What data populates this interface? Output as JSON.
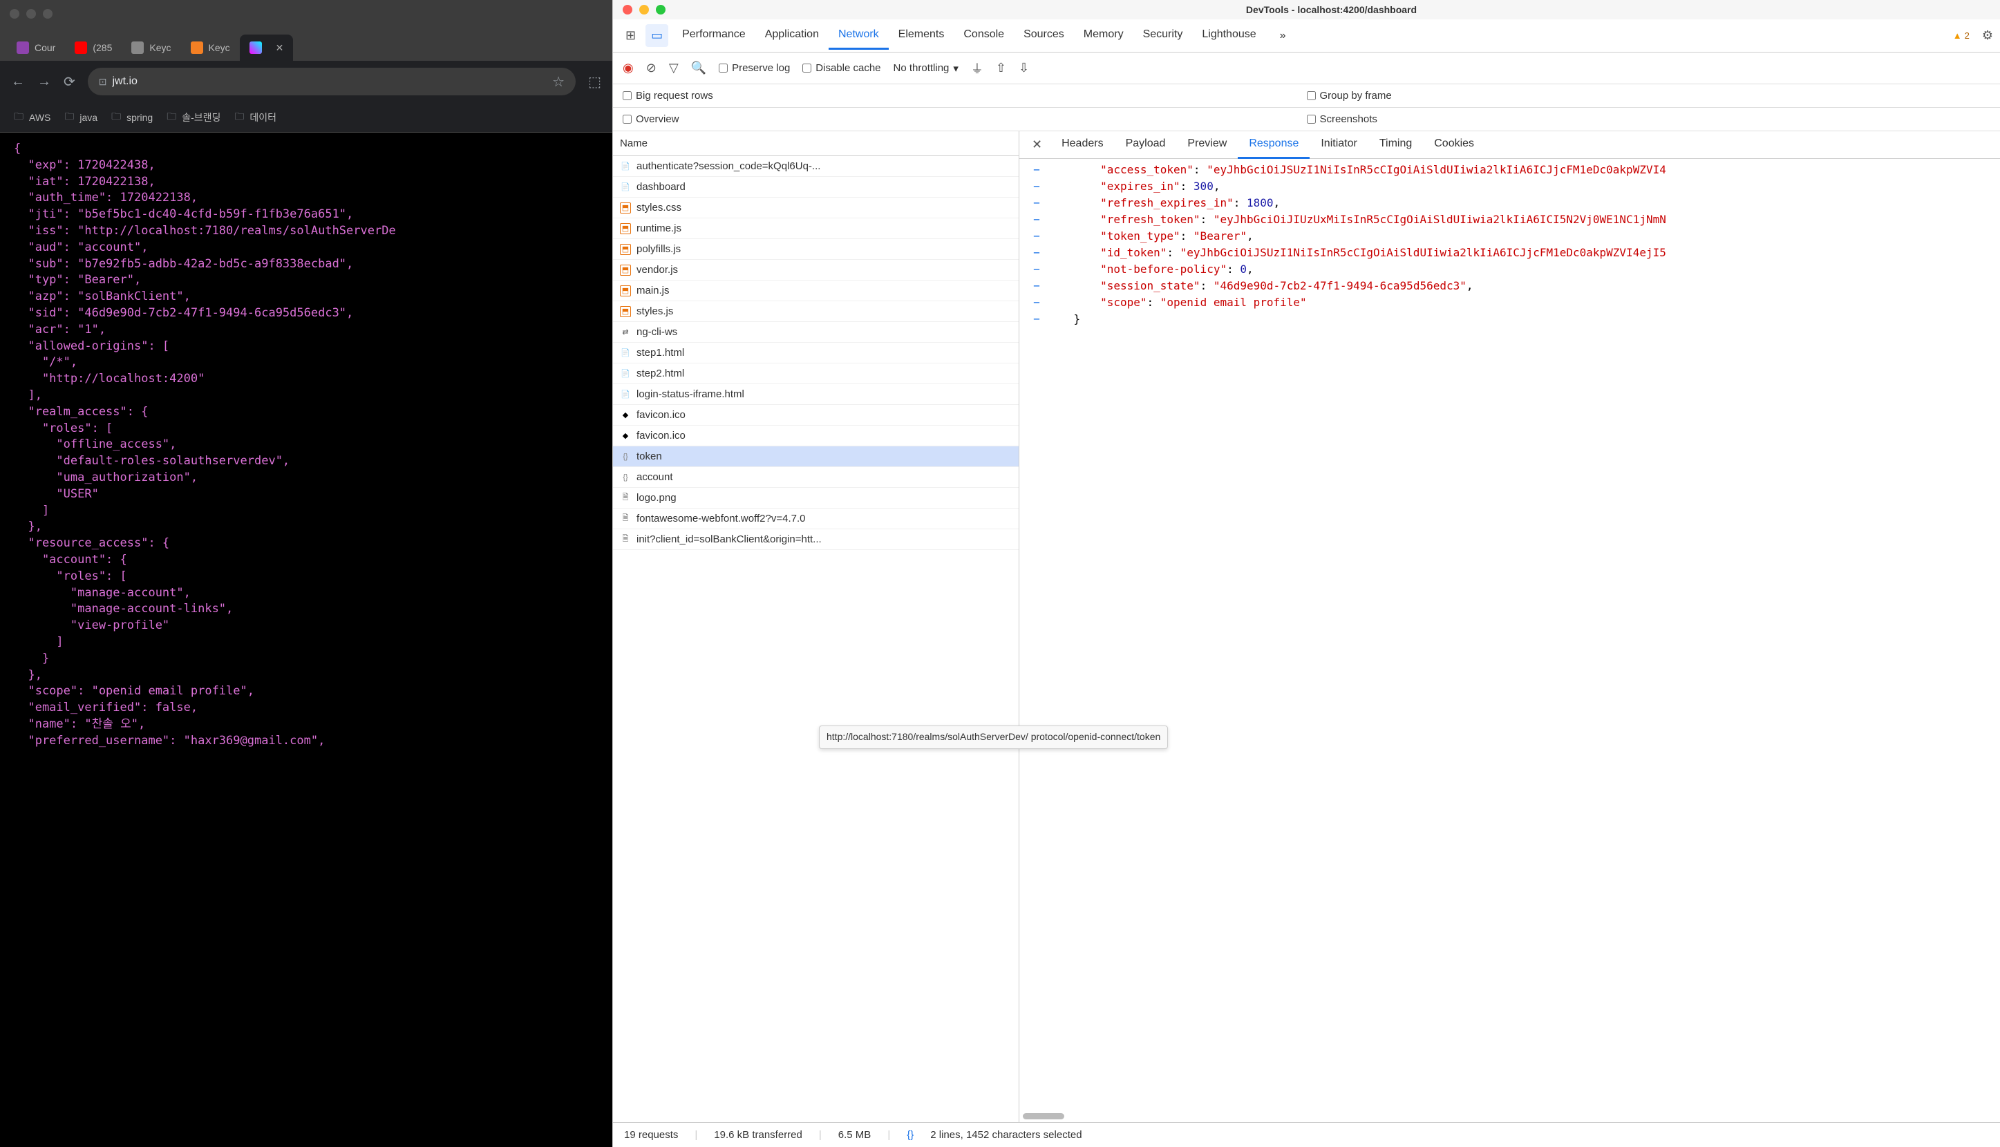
{
  "browser": {
    "tabs": [
      {
        "label": "Cour",
        "favicon": "purple"
      },
      {
        "label": "(285",
        "favicon": "red"
      },
      {
        "label": "Keyc",
        "favicon": "gray"
      },
      {
        "label": "Keyc",
        "favicon": "orange"
      },
      {
        "label": "",
        "favicon": "rainbow",
        "active": true
      }
    ],
    "url": "jwt.io",
    "bookmarks": [
      "AWS",
      "java",
      "spring",
      "솔-브랜딩",
      "데이터"
    ],
    "json_lines": [
      "{",
      "  \"exp\": 1720422438,",
      "  \"iat\": 1720422138,",
      "  \"auth_time\": 1720422138,",
      "  \"jti\": \"b5ef5bc1-dc40-4cfd-b59f-f1fb3e76a651\",",
      "  \"iss\": \"http://localhost:7180/realms/solAuthServerDe",
      "  \"aud\": \"account\",",
      "  \"sub\": \"b7e92fb5-adbb-42a2-bd5c-a9f8338ecbad\",",
      "  \"typ\": \"Bearer\",",
      "  \"azp\": \"solBankClient\",",
      "  \"sid\": \"46d9e90d-7cb2-47f1-9494-6ca95d56edc3\",",
      "  \"acr\": \"1\",",
      "  \"allowed-origins\": [",
      "    \"/*\",",
      "    \"http://localhost:4200\"",
      "  ],",
      "  \"realm_access\": {",
      "    \"roles\": [",
      "      \"offline_access\",",
      "      \"default-roles-solauthserverdev\",",
      "      \"uma_authorization\",",
      "      \"USER\"",
      "    ]",
      "  },",
      "  \"resource_access\": {",
      "    \"account\": {",
      "      \"roles\": [",
      "        \"manage-account\",",
      "        \"manage-account-links\",",
      "        \"view-profile\"",
      "      ]",
      "    }",
      "  },",
      "  \"scope\": \"openid email profile\",",
      "  \"email_verified\": false,",
      "  \"name\": \"찬솔 오\",",
      "  \"preferred_username\": \"haxr369@gmail.com\","
    ]
  },
  "devtools": {
    "title": "DevTools - localhost:4200/dashboard",
    "panels": [
      "Performance",
      "Application",
      "Network",
      "Elements",
      "Console",
      "Sources",
      "Memory",
      "Security",
      "Lighthouse"
    ],
    "active_panel": "Network",
    "warn_count": "2",
    "toolbar": {
      "preserve_log": "Preserve log",
      "disable_cache": "Disable cache",
      "throttling": "No throttling"
    },
    "sub_options": {
      "big_rows": "Big request rows",
      "overview": "Overview",
      "group_frame": "Group by frame",
      "screenshots": "Screenshots"
    },
    "requests_header": "Name",
    "requests": [
      {
        "name": "authenticate?session_code=kQql6Uq-...",
        "icon": "doc"
      },
      {
        "name": "dashboard",
        "icon": "doc"
      },
      {
        "name": "styles.css",
        "icon": "css"
      },
      {
        "name": "runtime.js",
        "icon": "js"
      },
      {
        "name": "polyfills.js",
        "icon": "js"
      },
      {
        "name": "vendor.js",
        "icon": "js"
      },
      {
        "name": "main.js",
        "icon": "js"
      },
      {
        "name": "styles.js",
        "icon": "js"
      },
      {
        "name": "ng-cli-ws",
        "icon": "ws"
      },
      {
        "name": "step1.html",
        "icon": "doc"
      },
      {
        "name": "step2.html",
        "icon": "doc"
      },
      {
        "name": "login-status-iframe.html",
        "icon": "doc"
      },
      {
        "name": "favicon.ico",
        "icon": "ico"
      },
      {
        "name": "favicon.ico",
        "icon": "ico"
      },
      {
        "name": "token",
        "icon": "brace",
        "selected": true
      },
      {
        "name": "account",
        "icon": "brace"
      },
      {
        "name": "logo.png",
        "icon": "file"
      },
      {
        "name": "fontawesome-webfont.woff2?v=4.7.0",
        "icon": "file"
      },
      {
        "name": "init?client_id=solBankClient&origin=htt...",
        "icon": "file"
      }
    ],
    "detail_tabs": [
      "Headers",
      "Payload",
      "Preview",
      "Response",
      "Initiator",
      "Timing",
      "Cookies"
    ],
    "active_detail_tab": "Response",
    "response": [
      {
        "indent": 2,
        "key": "access_token",
        "val": "\"eyJhbGciOiJSUzI1NiIsInR5cCIgOiAiSldUIiwia2lkIiA6ICJjcFM1eDc0akpWZVI4"
      },
      {
        "indent": 2,
        "key": "expires_in",
        "val": "300",
        "num": true,
        "comma": true
      },
      {
        "indent": 2,
        "key": "refresh_expires_in",
        "val": "1800",
        "num": true,
        "comma": true
      },
      {
        "indent": 2,
        "key": "refresh_token",
        "val": "\"eyJhbGciOiJIUzUxMiIsInR5cCIgOiAiSldUIiwia2lkIiA6ICI5N2Vj0WE1NC1jNmN"
      },
      {
        "indent": 2,
        "key": "token_type",
        "val": "\"Bearer\"",
        "comma": true
      },
      {
        "indent": 2,
        "key": "id_token",
        "val": "\"eyJhbGciOiJSUzI1NiIsInR5cCIgOiAiSldUIiwia2lkIiA6ICJjcFM1eDc0akpWZVI4ejI5"
      },
      {
        "indent": 2,
        "key": "not-before-policy",
        "val": "0",
        "num": true,
        "comma": true
      },
      {
        "indent": 2,
        "key": "session_state",
        "val": "\"46d9e90d-7cb2-47f1-9494-6ca95d56edc3\"",
        "comma": true
      },
      {
        "indent": 2,
        "key": "scope",
        "val": "\"openid email profile\""
      },
      {
        "indent": 1,
        "close": "}"
      }
    ],
    "tooltip": "http://localhost:7180/realms/solAuthServerDev/\nprotocol/openid-connect/token",
    "status": {
      "requests": "19 requests",
      "transfer": "19.6 kB transferred",
      "size": "6.5 MB",
      "selection": "2 lines, 1452 characters selected"
    }
  }
}
